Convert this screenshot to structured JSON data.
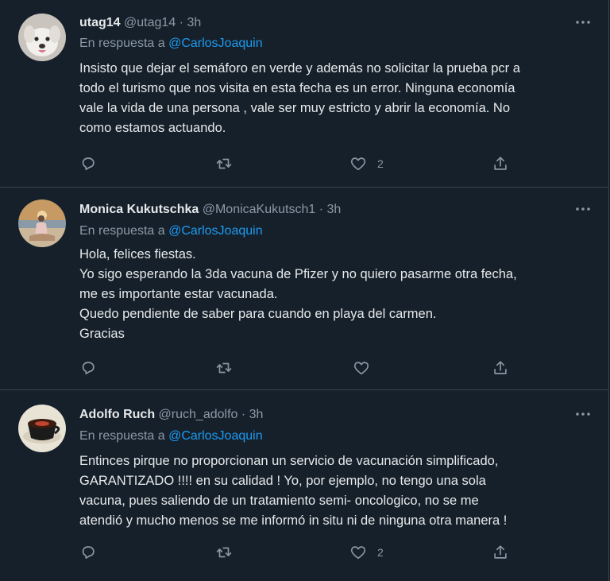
{
  "tweets": [
    {
      "name": "utag14",
      "handle": "@utag14",
      "dot": "·",
      "time": "3h",
      "reply_prefix": "En respuesta a",
      "reply_to": "@CarlosJoaquin",
      "text_lines": [
        "Insisto que dejar el semáforo en verde y además no solicitar la prueba pcr a",
        "todo el turismo que nos visita en esta fecha es un error. Ninguna economía",
        "vale la vida de una persona , vale ser muy estricto y abrir la economía. No",
        "como estamos actuando."
      ],
      "like_count": "2",
      "avatar_icon": "dog-avatar"
    },
    {
      "name": "Monica Kukutschka",
      "handle": "@MonicaKukutsch1",
      "dot": "·",
      "time": "3h",
      "reply_prefix": "En respuesta a",
      "reply_to": "@CarlosJoaquin",
      "text_lines": [
        "Hola, felices fiestas.",
        "Yo sigo esperando la 3da vacuna de Pfizer y no quiero pasarme otra fecha,",
        "me es importante estar vacunada.",
        "Quedo pendiente de saber para cuando en playa del carmen.",
        "Gracias"
      ],
      "like_count": "",
      "avatar_icon": "beach-photo-avatar"
    },
    {
      "name": "Adolfo Ruch",
      "handle": "@ruch_adolfo",
      "dot": "·",
      "time": "3h",
      "reply_prefix": "En respuesta a",
      "reply_to": "@CarlosJoaquin",
      "text_lines": [
        "Entinces pirque no proporcionan un servicio de vacunación simplificado,",
        "GARANTIZADO !!!! en su calidad ! Yo, por ejemplo, no tengo una sola",
        "vacuna, pues saliendo de un tratamiento semi- oncologico, no se me",
        "atendió y mucho menos se me informó in situ ni de ninguna otra manera !"
      ],
      "like_count": "2",
      "avatar_icon": "coffee-cup-avatar"
    }
  ],
  "colors": {
    "background": "#15202b",
    "border": "#38444d",
    "text": "#e7e9ea",
    "muted": "#8b98a5",
    "link": "#1d9bf0"
  },
  "icons": [
    "reply-icon",
    "retweet-icon",
    "like-icon",
    "share-icon",
    "more-options-icon"
  ]
}
